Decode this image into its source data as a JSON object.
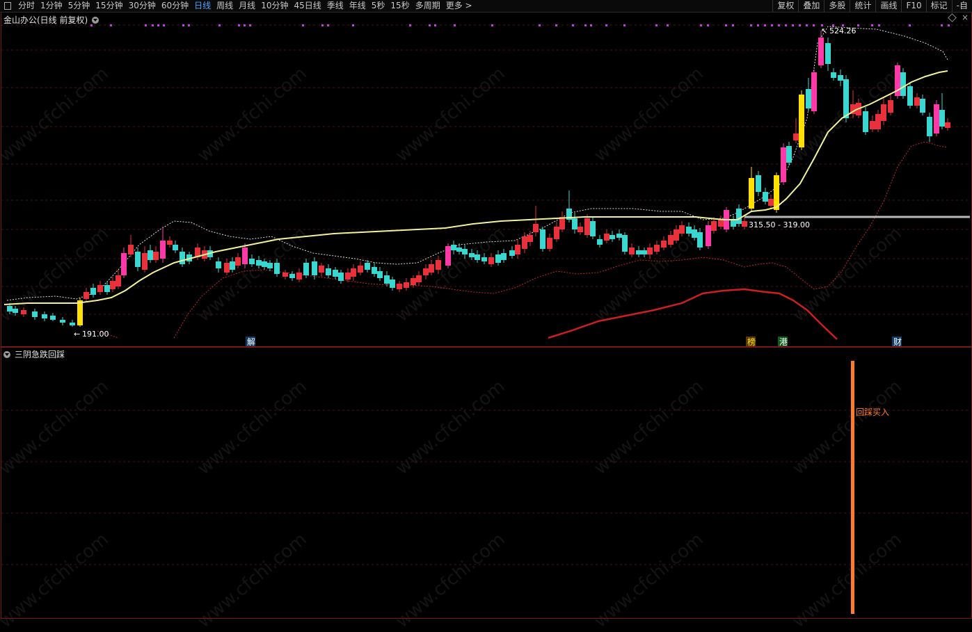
{
  "toolbar": {
    "left_icon": "panel-toggle-icon",
    "periods": [
      "分时",
      "1分钟",
      "5分钟",
      "15分钟",
      "30分钟",
      "60分钟",
      "日线",
      "周线",
      "月线",
      "10分钟",
      "45日线",
      "季线",
      "年线",
      "5秒",
      "15秒",
      "多周期",
      "更多 >"
    ],
    "active_period": "日线",
    "right_buttons": [
      "复权",
      "叠加",
      "多股",
      "统计",
      "画线",
      "F10",
      "标记",
      "-自"
    ]
  },
  "main_chart": {
    "title": "金山办公(日线 前复权)",
    "high_label": "524.26",
    "low_label": "191.00",
    "range_label": "315.50 - 319.00",
    "event_markers": [
      "解",
      "榜",
      "港",
      "财"
    ]
  },
  "sub_chart": {
    "title": "三阴急跌回踩",
    "signal_label": "回踩买入"
  },
  "watermark": "www.cfchi.com",
  "colors": {
    "up": "#e8313a",
    "down": "#3ad7d0",
    "pink": "#ff3aa8",
    "yellow": "#ffe000",
    "ma": "#f2f29a",
    "signal": "#ff7a2a",
    "grid": "#4a1010",
    "level_line": "#b8b8b8"
  }
}
